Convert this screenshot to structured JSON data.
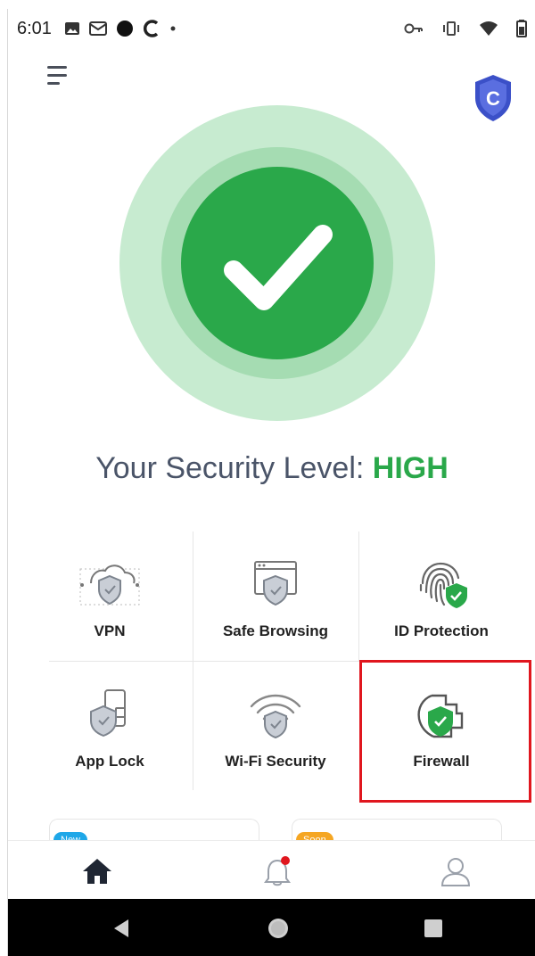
{
  "status_bar": {
    "time": "6:01",
    "icons_left": [
      "image-icon",
      "mail-icon",
      "circle-icon",
      "c-icon",
      "dot-icon"
    ],
    "icons_right": [
      "key-icon",
      "vibrate-icon",
      "wifi-icon",
      "battery-icon"
    ]
  },
  "header": {
    "menu_icon": "menu-icon",
    "logo_icon": "shield-c-logo-icon",
    "logo_letter": "C"
  },
  "security": {
    "label": "Your Security Level: ",
    "level": "HIGH",
    "status_icon": "checkmark-icon"
  },
  "features": [
    {
      "label": "VPN",
      "icon": "vpn-cloud-shield-icon"
    },
    {
      "label": "Safe Browsing",
      "icon": "browser-shield-icon"
    },
    {
      "label": "ID Protection",
      "icon": "fingerprint-shield-icon"
    },
    {
      "label": "App Lock",
      "icon": "app-lock-shield-icon"
    },
    {
      "label": "Wi-Fi Security",
      "icon": "wifi-shield-icon"
    },
    {
      "label": "Firewall",
      "icon": "firewall-shield-icon"
    }
  ],
  "cards": [
    {
      "badge": "New",
      "badge_color": "#1ea7e8"
    },
    {
      "badge": "Soon",
      "badge_color": "#f5a623"
    }
  ],
  "bottom_nav": [
    "home-icon",
    "notifications-icon",
    "profile-icon"
  ],
  "colors": {
    "accent_green": "#2aa84a",
    "highlight_red": "#e0161e",
    "logo_blue": "#3b50c8"
  }
}
